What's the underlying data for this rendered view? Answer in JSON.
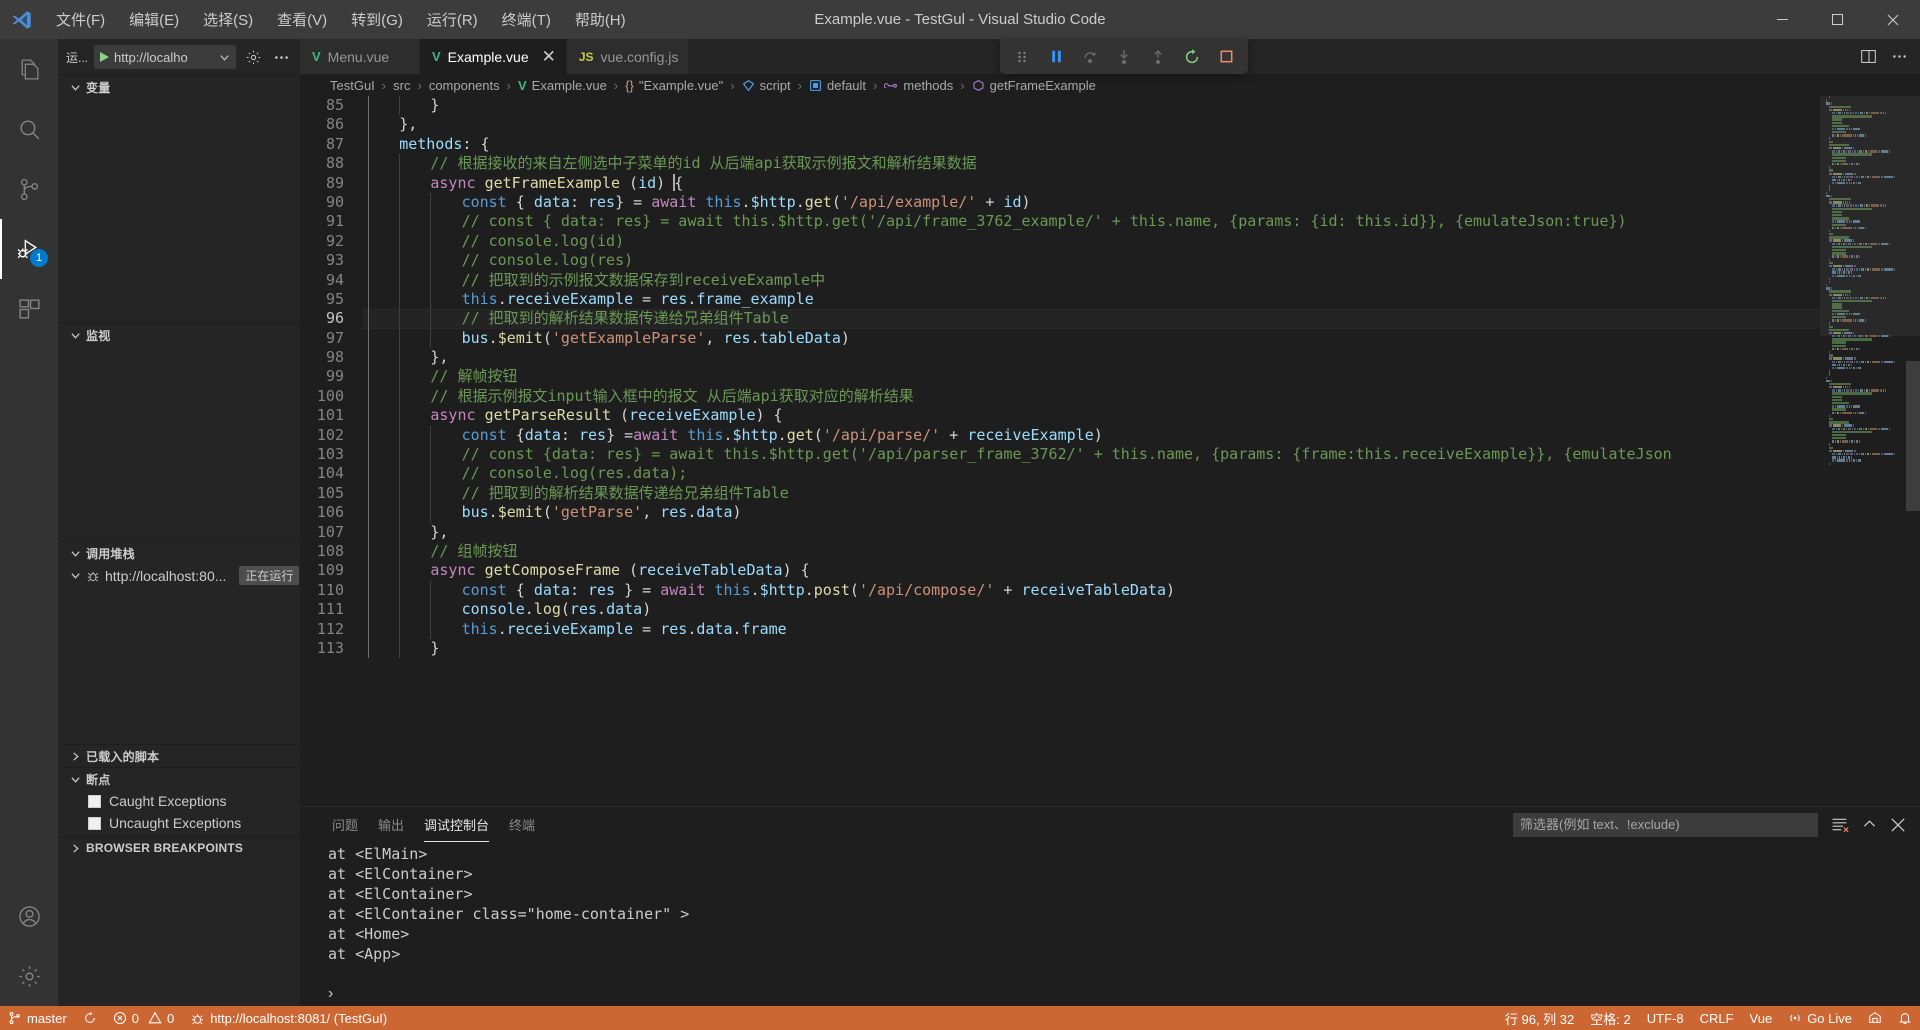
{
  "window": {
    "title": "Example.vue - TestGul - Visual Studio Code",
    "minimize_label": "—",
    "maximize_label": "❐",
    "close_label": "✕"
  },
  "menubar": {
    "items": [
      {
        "label": "文件(F)"
      },
      {
        "label": "编辑(E)"
      },
      {
        "label": "选择(S)"
      },
      {
        "label": "查看(V)"
      },
      {
        "label": "转到(G)"
      },
      {
        "label": "运行(R)"
      },
      {
        "label": "终端(T)"
      },
      {
        "label": "帮助(H)"
      }
    ]
  },
  "activitybar": {
    "items": [
      {
        "name": "explorer",
        "icon": "files-icon",
        "badge": ""
      },
      {
        "name": "search",
        "icon": "search-icon",
        "badge": ""
      },
      {
        "name": "source-control",
        "icon": "source-control-icon",
        "badge": ""
      },
      {
        "name": "run-and-debug",
        "icon": "run-debug-icon",
        "badge": "1"
      },
      {
        "name": "extensions",
        "icon": "extensions-icon",
        "badge": ""
      }
    ],
    "bottom": [
      {
        "name": "accounts",
        "icon": "account-icon"
      },
      {
        "name": "settings",
        "icon": "gear-icon"
      }
    ]
  },
  "sidebar": {
    "run_label": "运...",
    "config_value": "http://localho",
    "gear_title": "打开“launch.json”",
    "more_title": "...",
    "sections": {
      "variables": {
        "label": "变量",
        "expanded": true
      },
      "watch": {
        "label": "监视",
        "expanded": true
      },
      "callstack": {
        "label": "调用堆栈",
        "expanded": true,
        "items": [
          {
            "label": "http://localhost:80...",
            "state": "正在运行"
          }
        ]
      },
      "loaded_scripts": {
        "label": "已载入的脚本",
        "expanded": false
      },
      "breakpoints": {
        "label": "断点",
        "expanded": true,
        "items": [
          {
            "label": "Caught Exceptions",
            "checked": false
          },
          {
            "label": "Uncaught Exceptions",
            "checked": false
          }
        ]
      },
      "browser_breakpoints": {
        "label": "BROWSER BREAKPOINTS",
        "expanded": false
      }
    }
  },
  "editor": {
    "tabs": [
      {
        "label": "Menu.vue",
        "icon": "vue-file-icon",
        "active": false,
        "closable": false
      },
      {
        "label": "Example.vue",
        "icon": "vue-file-icon",
        "active": true,
        "closable": true,
        "close_label": "✕"
      },
      {
        "label": "vue.config.js",
        "icon": "js-file-icon",
        "active": false,
        "closable": false
      }
    ],
    "debug_toolbar": [
      {
        "name": "drag-handle",
        "title": "拖动"
      },
      {
        "name": "pause-button",
        "title": "暂停"
      },
      {
        "name": "step-over-button",
        "title": "单步跳过"
      },
      {
        "name": "step-into-button",
        "title": "单步调入"
      },
      {
        "name": "step-out-button",
        "title": "单步跳出"
      },
      {
        "name": "restart-button",
        "title": "重启"
      },
      {
        "name": "stop-button",
        "title": "停止"
      }
    ],
    "breadcrumbs": [
      {
        "label": "TestGuI",
        "icon": ""
      },
      {
        "label": "src",
        "icon": ""
      },
      {
        "label": "components",
        "icon": ""
      },
      {
        "label": "Example.vue",
        "icon": "vue-file-icon"
      },
      {
        "label": "\"Example.vue\"",
        "icon": "braces-icon"
      },
      {
        "label": "script",
        "icon": "vue-symbol-icon"
      },
      {
        "label": "default",
        "icon": "object-icon"
      },
      {
        "label": "methods",
        "icon": "method-icon"
      },
      {
        "label": "getFrameExample",
        "icon": "symbol-icon"
      }
    ],
    "first_line_number": 85,
    "current_line": 96
  },
  "code_lines": [
    {
      "n": 85,
      "indent": 2,
      "tokens": [
        {
          "t": "pun",
          "v": "}"
        }
      ]
    },
    {
      "n": 86,
      "indent": 1,
      "tokens": [
        {
          "t": "pun",
          "v": "},"
        }
      ]
    },
    {
      "n": 87,
      "indent": 1,
      "tokens": [
        {
          "t": "var",
          "v": "methods"
        },
        {
          "t": "pun",
          "v": ": {"
        }
      ]
    },
    {
      "n": 88,
      "indent": 2,
      "tokens": [
        {
          "t": "com",
          "v": "// 根据接收的来自左侧选中子菜单的id 从后端api获取示例报文和解析结果数据"
        }
      ]
    },
    {
      "n": 89,
      "indent": 2,
      "tokens": [
        {
          "t": "kw2",
          "v": "async "
        },
        {
          "t": "fn",
          "v": "getFrameExample"
        },
        {
          "t": "pun",
          "v": " ("
        },
        {
          "t": "var",
          "v": "id"
        },
        {
          "t": "pun",
          "v": ") "
        },
        {
          "t": "caret",
          "v": ""
        },
        {
          "t": "pun",
          "v": "{"
        }
      ]
    },
    {
      "n": 90,
      "indent": 3,
      "tokens": [
        {
          "t": "kw",
          "v": "const"
        },
        {
          "t": "pun",
          "v": " { "
        },
        {
          "t": "var",
          "v": "data"
        },
        {
          "t": "pun",
          "v": ": "
        },
        {
          "t": "var",
          "v": "res"
        },
        {
          "t": "pun",
          "v": "} = "
        },
        {
          "t": "kw2",
          "v": "await"
        },
        {
          "t": "pun",
          "v": " "
        },
        {
          "t": "kw",
          "v": "this"
        },
        {
          "t": "pun",
          "v": "."
        },
        {
          "t": "var",
          "v": "$http"
        },
        {
          "t": "pun",
          "v": "."
        },
        {
          "t": "fn",
          "v": "get"
        },
        {
          "t": "pun",
          "v": "("
        },
        {
          "t": "str",
          "v": "'/api/example/'"
        },
        {
          "t": "pun",
          "v": " + "
        },
        {
          "t": "var",
          "v": "id"
        },
        {
          "t": "pun",
          "v": ")"
        }
      ]
    },
    {
      "n": 91,
      "indent": 3,
      "tokens": [
        {
          "t": "com",
          "v": "// const { data: res} = await this.$http.get('/api/frame_3762_example/' + this.name, {params: {id: this.id}}, {emulateJson:true})"
        }
      ]
    },
    {
      "n": 92,
      "indent": 3,
      "tokens": [
        {
          "t": "com",
          "v": "// console.log(id)"
        }
      ]
    },
    {
      "n": 93,
      "indent": 3,
      "tokens": [
        {
          "t": "com",
          "v": "// console.log(res)"
        }
      ]
    },
    {
      "n": 94,
      "indent": 3,
      "tokens": [
        {
          "t": "com",
          "v": "// 把取到的示例报文数据保存到receiveExample中"
        }
      ]
    },
    {
      "n": 95,
      "indent": 3,
      "tokens": [
        {
          "t": "kw",
          "v": "this"
        },
        {
          "t": "pun",
          "v": "."
        },
        {
          "t": "var",
          "v": "receiveExample"
        },
        {
          "t": "pun",
          "v": " = "
        },
        {
          "t": "var",
          "v": "res"
        },
        {
          "t": "pun",
          "v": "."
        },
        {
          "t": "var",
          "v": "frame_example"
        }
      ]
    },
    {
      "n": 96,
      "indent": 3,
      "tokens": [
        {
          "t": "com",
          "v": "// 把取到的解析结果数据传递给兄弟组件Table"
        }
      ]
    },
    {
      "n": 97,
      "indent": 3,
      "tokens": [
        {
          "t": "var",
          "v": "bus"
        },
        {
          "t": "pun",
          "v": "."
        },
        {
          "t": "fn",
          "v": "$emit"
        },
        {
          "t": "pun",
          "v": "("
        },
        {
          "t": "str",
          "v": "'getExampleParse'"
        },
        {
          "t": "pun",
          "v": ", "
        },
        {
          "t": "var",
          "v": "res"
        },
        {
          "t": "pun",
          "v": "."
        },
        {
          "t": "var",
          "v": "tableData"
        },
        {
          "t": "pun",
          "v": ")"
        }
      ]
    },
    {
      "n": 98,
      "indent": 2,
      "tokens": [
        {
          "t": "pun",
          "v": "},"
        }
      ]
    },
    {
      "n": 99,
      "indent": 2,
      "tokens": [
        {
          "t": "com",
          "v": "// 解帧按钮"
        }
      ]
    },
    {
      "n": 100,
      "indent": 2,
      "tokens": [
        {
          "t": "com",
          "v": "// 根据示例报文input输入框中的报文 从后端api获取对应的解析结果"
        }
      ]
    },
    {
      "n": 101,
      "indent": 2,
      "tokens": [
        {
          "t": "kw2",
          "v": "async "
        },
        {
          "t": "fn",
          "v": "getParseResult"
        },
        {
          "t": "pun",
          "v": " ("
        },
        {
          "t": "var",
          "v": "receiveExample"
        },
        {
          "t": "pun",
          "v": ") {"
        }
      ]
    },
    {
      "n": 102,
      "indent": 3,
      "tokens": [
        {
          "t": "kw",
          "v": "const"
        },
        {
          "t": "pun",
          "v": " {"
        },
        {
          "t": "var",
          "v": "data"
        },
        {
          "t": "pun",
          "v": ": "
        },
        {
          "t": "var",
          "v": "res"
        },
        {
          "t": "pun",
          "v": "} ="
        },
        {
          "t": "kw2",
          "v": "await"
        },
        {
          "t": "pun",
          "v": " "
        },
        {
          "t": "kw",
          "v": "this"
        },
        {
          "t": "pun",
          "v": "."
        },
        {
          "t": "var",
          "v": "$http"
        },
        {
          "t": "pun",
          "v": "."
        },
        {
          "t": "fn",
          "v": "get"
        },
        {
          "t": "pun",
          "v": "("
        },
        {
          "t": "str",
          "v": "'/api/parse/'"
        },
        {
          "t": "pun",
          "v": " + "
        },
        {
          "t": "var",
          "v": "receiveExample"
        },
        {
          "t": "pun",
          "v": ")"
        }
      ]
    },
    {
      "n": 103,
      "indent": 3,
      "tokens": [
        {
          "t": "com",
          "v": "// const {data: res} = await this.$http.get('/api/parser_frame_3762/' + this.name, {params: {frame:this.receiveExample}}, {emulateJson"
        }
      ]
    },
    {
      "n": 104,
      "indent": 3,
      "tokens": [
        {
          "t": "com",
          "v": "// console.log(res.data);"
        }
      ]
    },
    {
      "n": 105,
      "indent": 3,
      "tokens": [
        {
          "t": "com",
          "v": "// 把取到的解析结果数据传递给兄弟组件Table"
        }
      ]
    },
    {
      "n": 106,
      "indent": 3,
      "tokens": [
        {
          "t": "var",
          "v": "bus"
        },
        {
          "t": "pun",
          "v": "."
        },
        {
          "t": "fn",
          "v": "$emit"
        },
        {
          "t": "pun",
          "v": "("
        },
        {
          "t": "str",
          "v": "'getParse'"
        },
        {
          "t": "pun",
          "v": ", "
        },
        {
          "t": "var",
          "v": "res"
        },
        {
          "t": "pun",
          "v": "."
        },
        {
          "t": "var",
          "v": "data"
        },
        {
          "t": "pun",
          "v": ")"
        }
      ]
    },
    {
      "n": 107,
      "indent": 2,
      "tokens": [
        {
          "t": "pun",
          "v": "},"
        }
      ]
    },
    {
      "n": 108,
      "indent": 2,
      "tokens": [
        {
          "t": "com",
          "v": "// 组帧按钮"
        }
      ]
    },
    {
      "n": 109,
      "indent": 2,
      "tokens": [
        {
          "t": "kw2",
          "v": "async "
        },
        {
          "t": "fn",
          "v": "getComposeFrame"
        },
        {
          "t": "pun",
          "v": " ("
        },
        {
          "t": "var",
          "v": "receiveTableData"
        },
        {
          "t": "pun",
          "v": ") {"
        }
      ]
    },
    {
      "n": 110,
      "indent": 3,
      "tokens": [
        {
          "t": "kw",
          "v": "const"
        },
        {
          "t": "pun",
          "v": " { "
        },
        {
          "t": "var",
          "v": "data"
        },
        {
          "t": "pun",
          "v": ": "
        },
        {
          "t": "var",
          "v": "res"
        },
        {
          "t": "pun",
          "v": " } = "
        },
        {
          "t": "kw2",
          "v": "await"
        },
        {
          "t": "pun",
          "v": " "
        },
        {
          "t": "kw",
          "v": "this"
        },
        {
          "t": "pun",
          "v": "."
        },
        {
          "t": "var",
          "v": "$http"
        },
        {
          "t": "pun",
          "v": "."
        },
        {
          "t": "fn",
          "v": "post"
        },
        {
          "t": "pun",
          "v": "("
        },
        {
          "t": "str",
          "v": "'/api/compose/'"
        },
        {
          "t": "pun",
          "v": " + "
        },
        {
          "t": "var",
          "v": "receiveTableData"
        },
        {
          "t": "pun",
          "v": ")"
        }
      ]
    },
    {
      "n": 111,
      "indent": 3,
      "tokens": [
        {
          "t": "var",
          "v": "console"
        },
        {
          "t": "pun",
          "v": "."
        },
        {
          "t": "fn",
          "v": "log"
        },
        {
          "t": "pun",
          "v": "("
        },
        {
          "t": "var",
          "v": "res"
        },
        {
          "t": "pun",
          "v": "."
        },
        {
          "t": "var",
          "v": "data"
        },
        {
          "t": "pun",
          "v": ")"
        }
      ]
    },
    {
      "n": 112,
      "indent": 3,
      "tokens": [
        {
          "t": "kw",
          "v": "this"
        },
        {
          "t": "pun",
          "v": "."
        },
        {
          "t": "var",
          "v": "receiveExample"
        },
        {
          "t": "pun",
          "v": " = "
        },
        {
          "t": "var",
          "v": "res"
        },
        {
          "t": "pun",
          "v": "."
        },
        {
          "t": "var",
          "v": "data"
        },
        {
          "t": "pun",
          "v": "."
        },
        {
          "t": "var",
          "v": "frame"
        }
      ]
    },
    {
      "n": 113,
      "indent": 2,
      "tokens": [
        {
          "t": "pun",
          "v": "}"
        }
      ]
    }
  ],
  "panel": {
    "tabs": [
      {
        "label": "问题",
        "active": false
      },
      {
        "label": "输出",
        "active": false
      },
      {
        "label": "调试控制台",
        "active": true
      },
      {
        "label": "终端",
        "active": false
      }
    ],
    "filter_placeholder": "筛选器(例如 text、!exclude)",
    "filter_value": "",
    "actions": [
      {
        "name": "clear-console-button",
        "title": "清除控制台"
      },
      {
        "name": "maximize-panel-button",
        "title": "最大化面板大小"
      },
      {
        "name": "close-panel-button",
        "title": "关闭面板"
      }
    ],
    "console_lines": [
      "at <ElMain>",
      "at <ElContainer>",
      "at <ElContainer>",
      "at <ElContainer class=\"home-container\" >",
      "at <Home>",
      "at <App>"
    ],
    "prompt_symbol": "›"
  },
  "statusbar": {
    "left": [
      {
        "name": "remote-branch",
        "icon": "git-branch-icon",
        "label": "master"
      },
      {
        "name": "sync-status",
        "icon": "sync-icon",
        "label": ""
      },
      {
        "name": "problems",
        "icon": "error-warning-icon",
        "label": "0  0",
        "errors": "0",
        "warnings": "0"
      },
      {
        "name": "debug-target",
        "icon": "debug-icon",
        "label": "http://localhost:8081/ (TestGuI)"
      }
    ],
    "right": [
      {
        "name": "cursor-position",
        "label": "行 96, 列 32"
      },
      {
        "name": "indentation",
        "label": "空格: 2"
      },
      {
        "name": "encoding",
        "label": "UTF-8"
      },
      {
        "name": "eol",
        "label": "CRLF"
      },
      {
        "name": "language-mode",
        "label": "Vue"
      },
      {
        "name": "go-live",
        "label": "Go Live",
        "icon": "broadcast-icon"
      },
      {
        "name": "remote-indicator",
        "label": "",
        "icon": "remote-icon"
      },
      {
        "name": "notifications",
        "label": "",
        "icon": "bell-icon"
      }
    ]
  },
  "colors": {
    "accent": "#007acc",
    "status_bar": "#cc6633",
    "titlebar": "#3c3c3c",
    "sidebar": "#252526",
    "editor": "#1e1e1e",
    "vue_green": "#41b883",
    "js_yellow": "#cbcb41",
    "comment_green": "#6a9955",
    "string_orange": "#ce9178",
    "keyword_blue": "#569cd6",
    "function_yellow": "#dcdcaa",
    "variable_blue": "#9cdcfe",
    "control_purple": "#c586c0"
  }
}
